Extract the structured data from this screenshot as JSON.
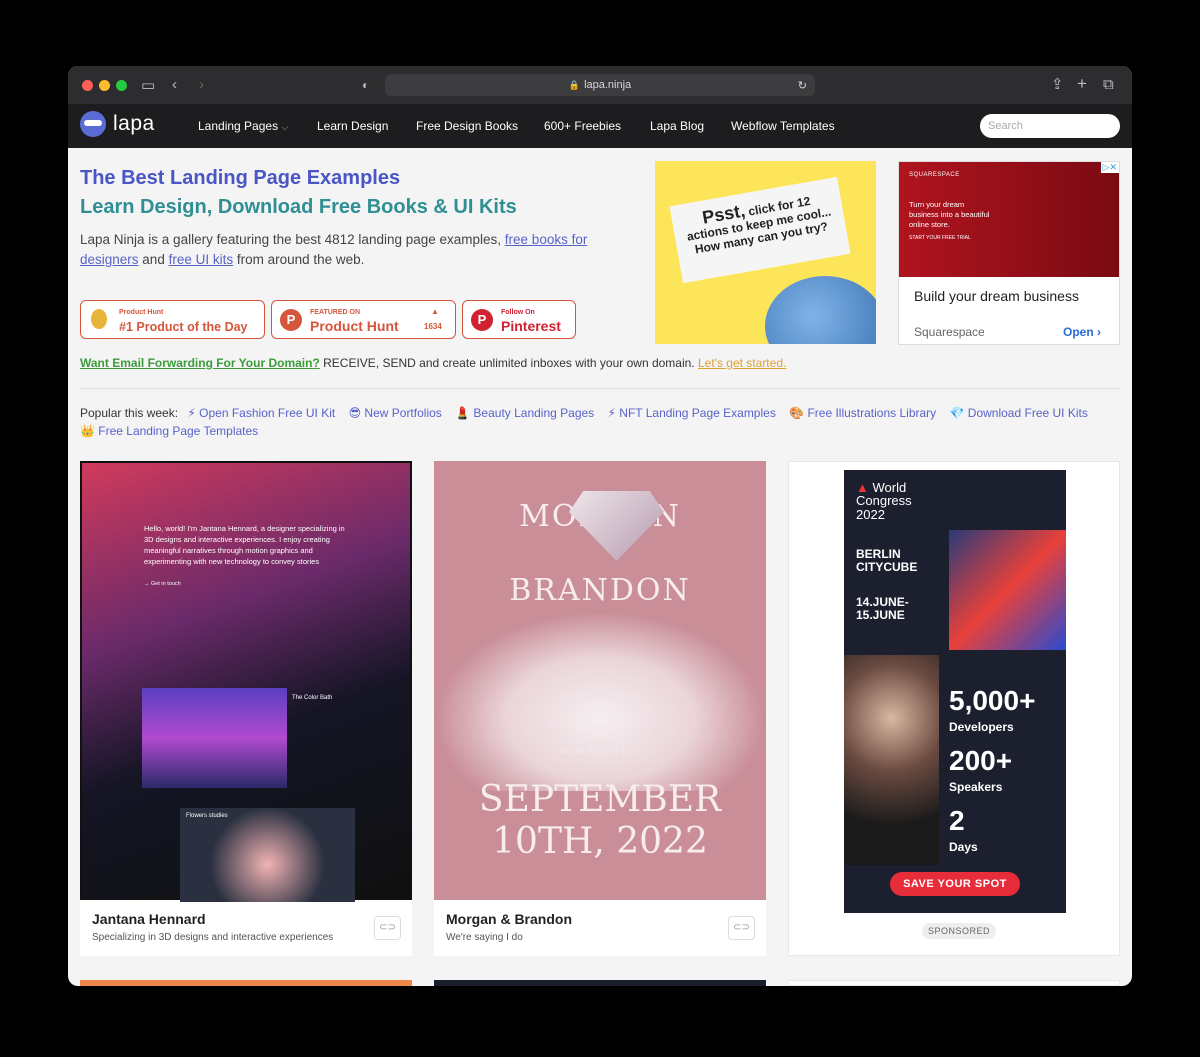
{
  "browser": {
    "url": "lapa.ninja"
  },
  "nav": {
    "logo": "lapa",
    "items": [
      "Landing Pages",
      "Learn Design",
      "Free Design Books",
      "600+ Freebies",
      "Lapa Blog",
      "Webflow Templates"
    ],
    "search_placeholder": "Search"
  },
  "hero": {
    "title1": "The Best Landing Page Examples",
    "title2": "Learn Design, Download Free Books & UI Kits",
    "intro_a": "Lapa Ninja is a gallery featuring the best 4812 landing page examples, ",
    "link1": "free books for designers",
    "intro_b": " and ",
    "link2": "free UI kits",
    "intro_c": " from around the web."
  },
  "badges": {
    "ph_day_small": "Product Hunt",
    "ph_day_big": "#1 Product of the Day",
    "ph_feat_small": "FEATURED ON",
    "ph_feat_big": "Product Hunt",
    "ph_count": "1634",
    "pin_small": "Follow On",
    "pin_big": "Pinterest"
  },
  "email": {
    "lead": "Want Email Forwarding For Your Domain?",
    "body": " RECEIVE, SEND and create unlimited inboxes with your own domain. ",
    "cta": "Let's get started."
  },
  "popular": {
    "label": "Popular this week:",
    "items": [
      "⚡ Open Fashion Free UI Kit",
      "😎 New Portfolios",
      "💄 Beauty Landing Pages",
      "⚡ NFT Landing Page Examples",
      "🎨 Free Illustrations Library",
      "💎 Download Free UI Kits",
      "👑 Free Landing Page Templates"
    ]
  },
  "ad_left": {
    "line1": "Psst,",
    "line2": "click for 12",
    "line3": "actions to keep me cool...",
    "line4": "How many can you try?"
  },
  "ad_right": {
    "brand": "SQUARESPACE",
    "tag": "Turn your dream business into a beautiful online store.",
    "cta_small": "START YOUR FREE TRIAL",
    "title": "Build your dream business",
    "footer": "Squarespace",
    "open": "Open"
  },
  "cards": [
    {
      "title": "Jantana Hennard",
      "subtitle": "Specializing in 3D designs and interactive experiences",
      "preview": "Hello, world! I'm Jantana Hennard, a designer specializing in 3D designs and interactive experiences. I enjoy creating meaningful narratives through motion graphics and experimenting with new technology to convey stories",
      "preview_cta": "→ Get in touch",
      "preview_label1": "The Color Bath",
      "preview_label2": "Flowers studies"
    },
    {
      "title": "Morgan & Brandon",
      "subtitle": "We're saying I do",
      "preview_top1": "MORGAN",
      "preview_top2": "BRANDON",
      "preview_small": "WE'RE SAYING I DO",
      "preview_bot1": "SEPTEMBER",
      "preview_bot2": "10TH, 2022"
    }
  ],
  "ad_card": {
    "l1": "World",
    "l2": "Congress",
    "l3": "2022",
    "city1": "BERLIN",
    "city2": "CITYCUBE",
    "date1": "14.JUNE-",
    "date2": "15.JUNE",
    "n1": "5,000+",
    "t1": "Developers",
    "n2": "200+",
    "t2": "Speakers",
    "n3": "2",
    "t3": "Days",
    "cta": "SAVE YOUR SPOT",
    "sponsored": "SPONSORED"
  }
}
